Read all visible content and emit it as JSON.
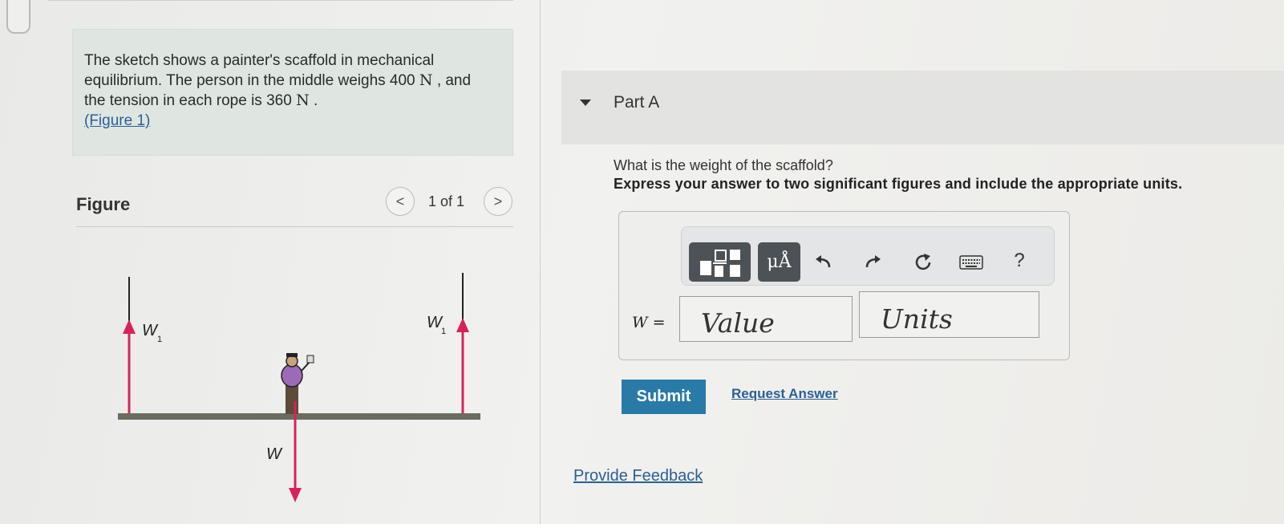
{
  "problem": {
    "line1": "The sketch shows a painter's scaffold in mechanical",
    "line2_a": "equilibrium. The person in the middle weighs 400",
    "line2_unit": "N",
    "line2_b": ", and",
    "line3_a": "the tension in each rope is 360",
    "line3_unit": "N",
    "line3_b": ".",
    "figure_link": "(Figure 1)"
  },
  "figure": {
    "title": "Figure",
    "pager": {
      "prev_icon": "chevron-left-icon",
      "next_icon": "chevron-right-icon",
      "prev": "<",
      "next": ">",
      "count": "1 of 1"
    },
    "labels": {
      "w1_left": "W",
      "w1_right": "W",
      "subscript": "1",
      "w": "W"
    },
    "arrow_color": "#d6245a"
  },
  "part_a": {
    "title": "Part A",
    "question": "What is the weight of the scaffold?",
    "instruction": "Express your answer to two significant figures and include the appropriate units.",
    "toolbar": {
      "units_label": "μÅ",
      "help_label": "?",
      "icons": [
        "templates-icon",
        "units-icon",
        "undo-icon",
        "redo-icon",
        "reset-icon",
        "keyboard-icon",
        "help-icon"
      ]
    },
    "variable": "W",
    "equals": "=",
    "value_placeholder": "Value",
    "units_placeholder": "Units",
    "submit_label": "Submit",
    "request_answer": "Request Answer"
  },
  "feedback": "Provide Feedback",
  "colors": {
    "accent": "#2a7aa8",
    "link": "#2b5f93",
    "intro_bg": "#dfe6e2",
    "toolbar_btn": "#4d5257"
  }
}
